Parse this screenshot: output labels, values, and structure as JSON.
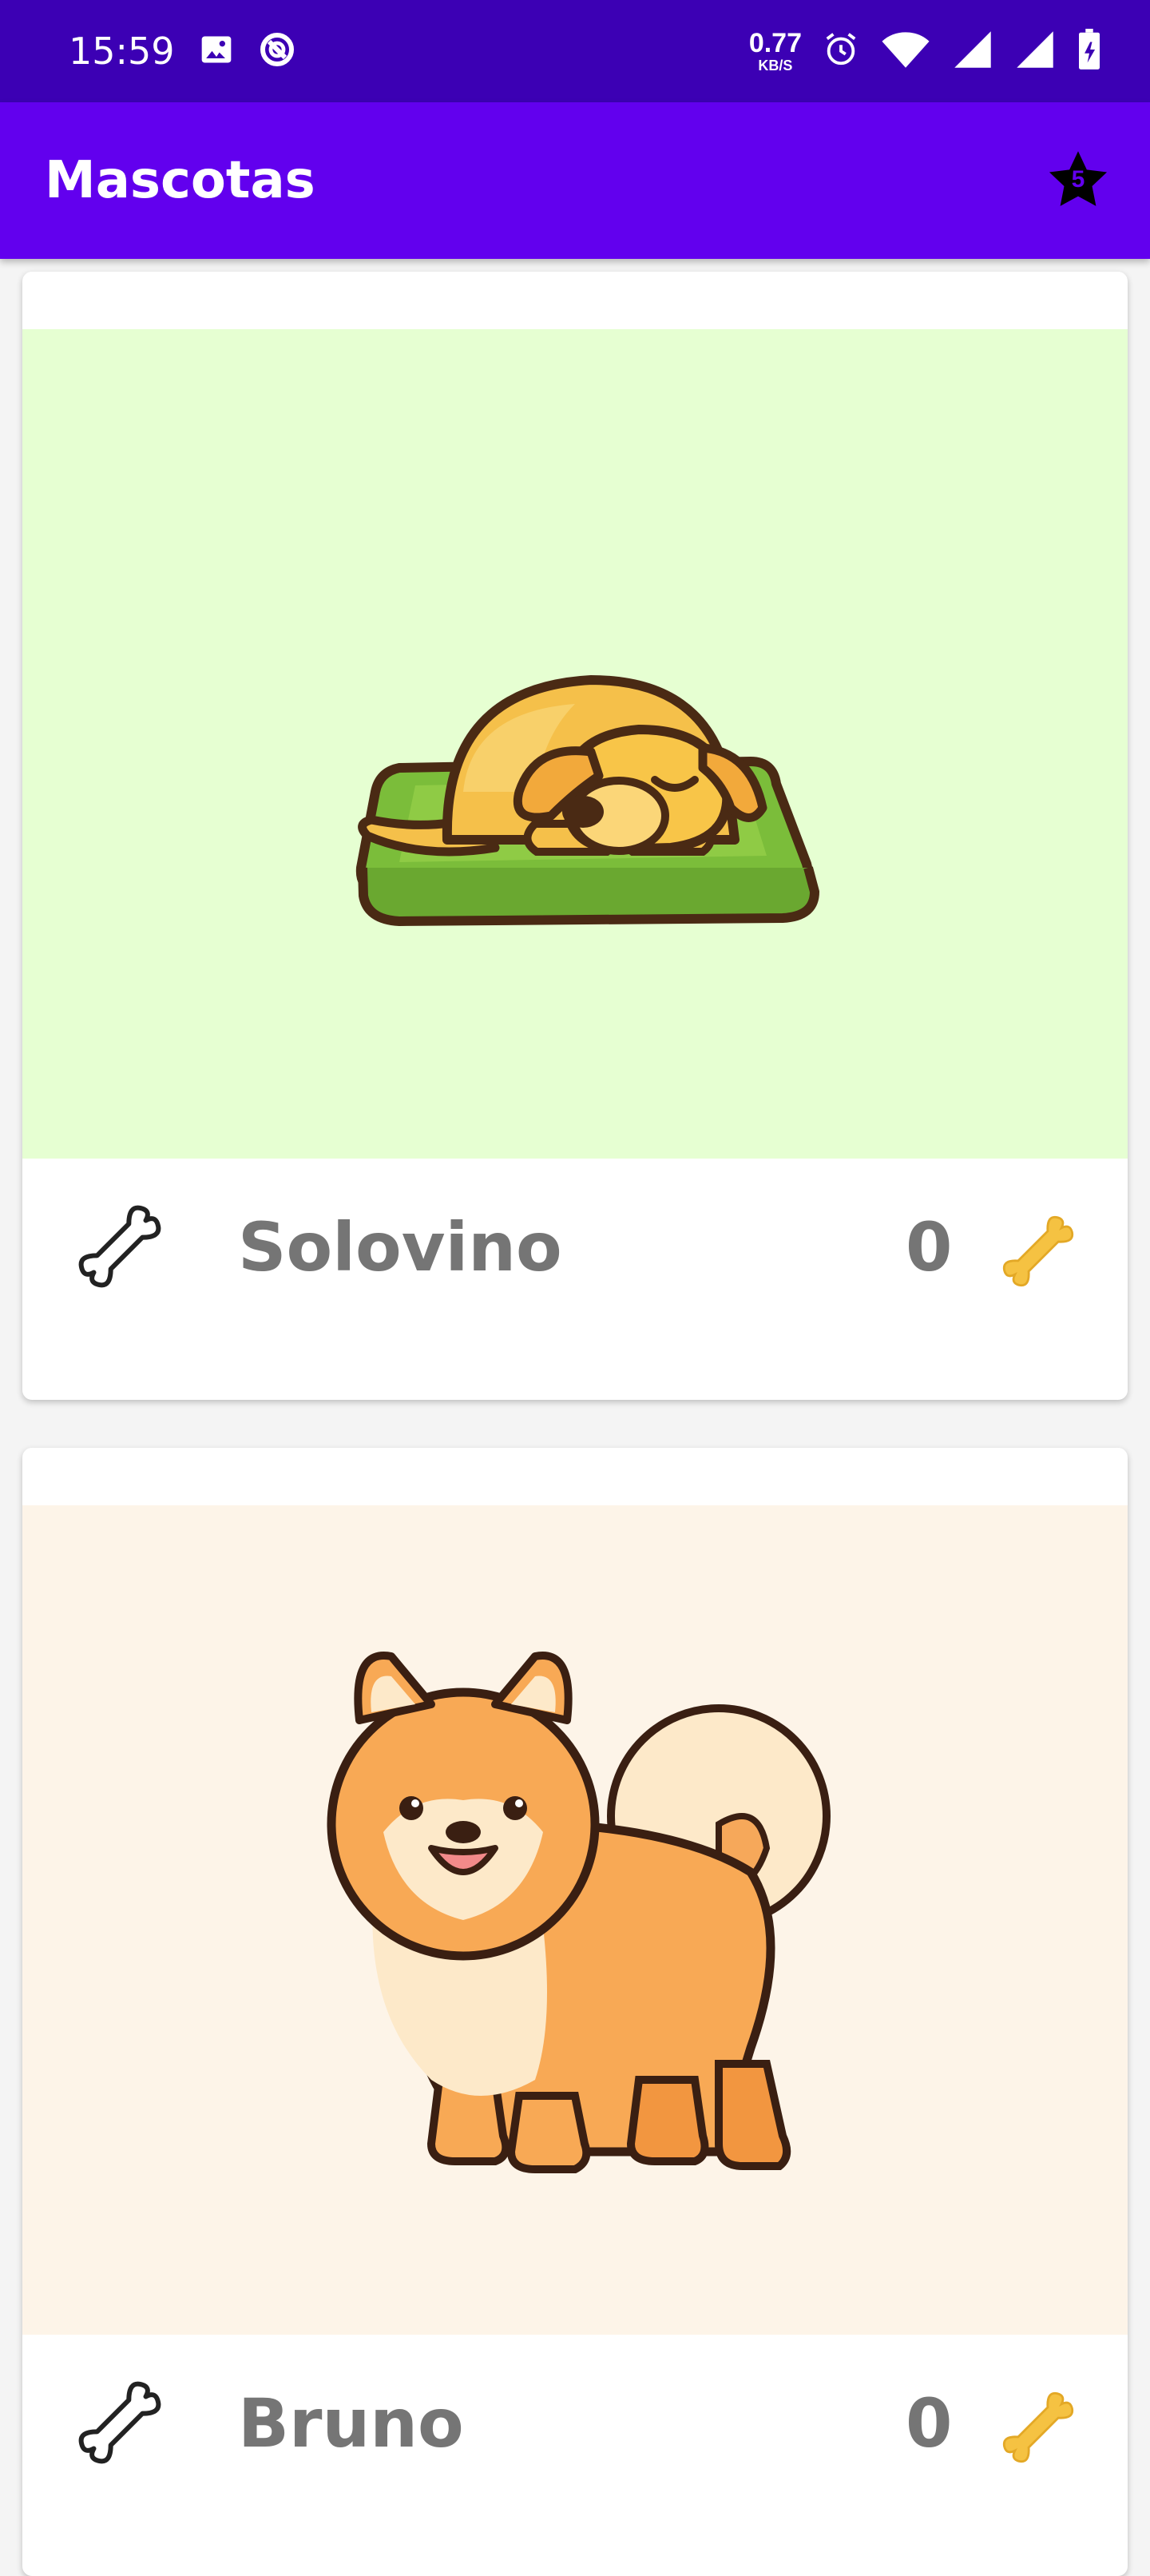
{
  "status_bar": {
    "time": "15:59",
    "net_speed_value": "0.77",
    "net_speed_unit": "KB/S",
    "icons": [
      "image-icon",
      "sync-icon",
      "alarm-icon",
      "wifi-icon",
      "signal-icon",
      "signal-icon-2",
      "battery-icon"
    ]
  },
  "app_bar": {
    "title": "Mascotas",
    "action_icon": "star-rating-icon",
    "action_badge": "5"
  },
  "pets": [
    {
      "name": "Solovino",
      "rating": "0",
      "bg_color": "#e6ffd2",
      "illustration": "sleeping-dog"
    },
    {
      "name": "Bruno",
      "rating": "0",
      "bg_color": "#fdf4e8",
      "illustration": "pomeranian-dog"
    }
  ],
  "colors": {
    "status_bar": "#3c00b4",
    "app_bar": "#6200ee",
    "name_text": "#757575",
    "gold_bone": "#f5c242"
  }
}
